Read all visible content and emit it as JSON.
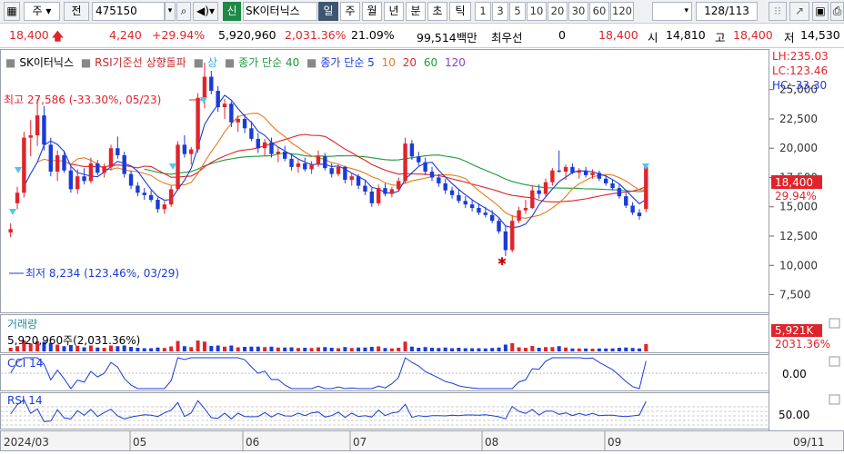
{
  "toolbar": {
    "market": "주",
    "prev_label": "전",
    "code": "475150",
    "new_label": "신",
    "stock_name": "SK이터닉스",
    "day": "일",
    "week": "주",
    "month": "월",
    "year": "년",
    "minute": "분",
    "tick_sec": "초",
    "tick": "틱",
    "periods": [
      "1",
      "3",
      "5",
      "10",
      "20",
      "30",
      "60",
      "120"
    ],
    "count": "128",
    "count_total": "/113"
  },
  "quote": {
    "price": "18,400",
    "change": "4,240",
    "change_pct": "+29.94%",
    "volume": "5,920,960",
    "volume_pct": "2,031.36%",
    "turnover": "21.09%",
    "trade_value": "99,514백만",
    "priority_label": "최우선",
    "priority_value": "0",
    "price2": "18,400",
    "open_label": "시",
    "open": "14,810",
    "high_label": "고",
    "high": "18,400",
    "low_label": "저",
    "low": "14,530"
  },
  "legend": {
    "stock": "SK이터닉스",
    "rsi_line": "RSI기준선 상향돌파",
    "rsi_dir": "상",
    "ma_label": "종가 단순 40",
    "ma_label2": "종가 단순 5",
    "ma10": "10",
    "ma20": "20",
    "ma60": "60",
    "ma120": "120"
  },
  "annotations": {
    "max": "최고 27,586 (-33.30%, 05/23)",
    "min": "최저 8,234 (123.46%, 03/29)",
    "lh": "LH:235.03",
    "lc": "LC:123.46",
    "hc": "HC:-33.30",
    "price_tag": "18,400",
    "pct_tag": "29.94%"
  },
  "volume_panel": {
    "title": "거래량",
    "value": "5,920,960주(2,031.36%)",
    "tag1": "5,921K",
    "tag2": "2031.36%"
  },
  "cci_panel": {
    "title": "CCI 14",
    "tick": "0.00"
  },
  "rsi_panel": {
    "title": "RSI 14",
    "tick": "50.00"
  },
  "price_axis": [
    "25,000",
    "22,500",
    "20,000",
    "17,500",
    "15,000",
    "12,500",
    "10,000",
    "7,500"
  ],
  "date_axis": [
    "2024/03",
    "05",
    "06",
    "07",
    "08",
    "09",
    "09/11"
  ],
  "colors": {
    "up": "#e0242b",
    "down": "#1a3bd8",
    "bg": "#ffffff"
  },
  "chart_data": {
    "type": "candlestick",
    "price_range": [
      6300,
      28000
    ],
    "ohlc": [
      [
        12800,
        13600,
        12400,
        13100
      ],
      [
        15300,
        16700,
        14800,
        16200
      ],
      [
        16200,
        21400,
        15800,
        20900
      ],
      [
        20900,
        22400,
        19300,
        21100
      ],
      [
        21100,
        24200,
        20200,
        22800
      ],
      [
        22800,
        23600,
        19800,
        20300
      ],
      [
        20300,
        20900,
        17600,
        18000
      ],
      [
        18000,
        19800,
        17200,
        19400
      ],
      [
        19400,
        19800,
        17900,
        18100
      ],
      [
        18100,
        18600,
        16200,
        16500
      ],
      [
        16500,
        18200,
        16100,
        17600
      ],
      [
        17600,
        18300,
        16900,
        17200
      ],
      [
        17200,
        19200,
        17000,
        18700
      ],
      [
        18700,
        19000,
        17700,
        17900
      ],
      [
        17900,
        18700,
        17500,
        18400
      ],
      [
        18400,
        20300,
        18100,
        20000
      ],
      [
        20000,
        21000,
        19100,
        19400
      ],
      [
        19400,
        19700,
        17500,
        17800
      ],
      [
        17800,
        18100,
        16500,
        16800
      ],
      [
        16800,
        17100,
        15900,
        16200
      ],
      [
        16200,
        16600,
        15600,
        16000
      ],
      [
        16000,
        16400,
        15400,
        15600
      ],
      [
        15600,
        15800,
        14500,
        14800
      ],
      [
        14800,
        15500,
        14400,
        15200
      ],
      [
        15200,
        16800,
        15000,
        16500
      ],
      [
        16500,
        20600,
        16400,
        20300
      ],
      [
        20300,
        21100,
        19200,
        19500
      ],
      [
        19500,
        20100,
        18600,
        19900
      ],
      [
        19900,
        24700,
        19600,
        24300
      ],
      [
        24300,
        27300,
        23400,
        26100
      ],
      [
        26100,
        26600,
        24600,
        24900
      ],
      [
        24900,
        25300,
        23100,
        23500
      ],
      [
        23500,
        24200,
        22500,
        23800
      ],
      [
        23800,
        24000,
        21800,
        22200
      ],
      [
        22200,
        22800,
        21400,
        22500
      ],
      [
        22500,
        22900,
        21300,
        21700
      ],
      [
        21700,
        22300,
        20600,
        20800
      ],
      [
        20800,
        21300,
        19600,
        20000
      ],
      [
        20000,
        20800,
        19300,
        20500
      ],
      [
        20500,
        20900,
        19200,
        19500
      ],
      [
        19500,
        20100,
        18800,
        19700
      ],
      [
        19700,
        20200,
        18900,
        19100
      ],
      [
        19100,
        19500,
        18100,
        18400
      ],
      [
        18400,
        19000,
        17900,
        18700
      ],
      [
        18700,
        19200,
        18000,
        18200
      ],
      [
        18200,
        18900,
        17800,
        18600
      ],
      [
        18600,
        19800,
        18400,
        19300
      ],
      [
        19300,
        19600,
        18100,
        18300
      ],
      [
        18300,
        18700,
        17500,
        17800
      ],
      [
        17800,
        18600,
        17600,
        18400
      ],
      [
        18400,
        18500,
        17000,
        17300
      ],
      [
        17300,
        17900,
        16800,
        17600
      ],
      [
        17600,
        17800,
        16500,
        16800
      ],
      [
        16800,
        17300,
        16000,
        16300
      ],
      [
        16300,
        16600,
        15000,
        15300
      ],
      [
        15300,
        16900,
        15100,
        16600
      ],
      [
        16600,
        17000,
        15900,
        16100
      ],
      [
        16100,
        16700,
        15800,
        16500
      ],
      [
        16500,
        17500,
        16300,
        17200
      ],
      [
        17200,
        20900,
        17000,
        20400
      ],
      [
        20400,
        20700,
        19000,
        19300
      ],
      [
        19300,
        19700,
        18500,
        18800
      ],
      [
        18800,
        19200,
        17700,
        18000
      ],
      [
        18000,
        18400,
        17200,
        17500
      ],
      [
        17500,
        17800,
        16700,
        17000
      ],
      [
        17000,
        17400,
        16100,
        16400
      ],
      [
        16400,
        16700,
        15700,
        16000
      ],
      [
        16000,
        16500,
        15300,
        15500
      ],
      [
        15500,
        15900,
        14900,
        15200
      ],
      [
        15200,
        15600,
        14600,
        14900
      ],
      [
        14900,
        15300,
        14300,
        14500
      ],
      [
        14500,
        15000,
        14100,
        14300
      ],
      [
        14300,
        14700,
        13600,
        13800
      ],
      [
        13800,
        14000,
        12700,
        12900
      ],
      [
        12900,
        13400,
        10800,
        11300
      ],
      [
        11300,
        14300,
        11100,
        13800
      ],
      [
        13800,
        15000,
        13600,
        14700
      ],
      [
        14700,
        15600,
        14400,
        14900
      ],
      [
        14900,
        16800,
        14800,
        16400
      ],
      [
        16400,
        16900,
        15700,
        16100
      ],
      [
        16100,
        17400,
        15900,
        17100
      ],
      [
        17100,
        18300,
        16800,
        18100
      ],
      [
        18100,
        19800,
        17900,
        18000
      ],
      [
        18000,
        18600,
        17300,
        18400
      ],
      [
        18400,
        18700,
        17800,
        17900
      ],
      [
        17900,
        18300,
        17400,
        18100
      ],
      [
        18100,
        18400,
        17500,
        17700
      ],
      [
        17700,
        18200,
        17400,
        17900
      ],
      [
        17900,
        18100,
        17200,
        17400
      ],
      [
        17400,
        17700,
        16800,
        17000
      ],
      [
        17000,
        17300,
        16400,
        16600
      ],
      [
        16600,
        16900,
        15700,
        15900
      ],
      [
        15900,
        16200,
        14900,
        15100
      ],
      [
        15100,
        15400,
        14300,
        14500
      ],
      [
        14500,
        14800,
        13900,
        14200
      ],
      [
        14810,
        18400,
        14530,
        18400
      ]
    ]
  }
}
